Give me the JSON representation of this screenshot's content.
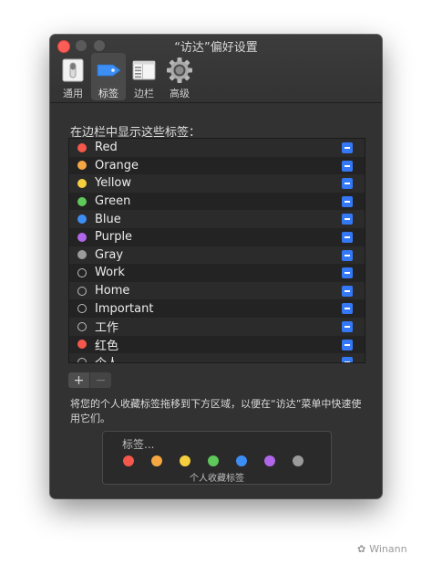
{
  "window": {
    "title": "“访达”偏好设置"
  },
  "toolbar": {
    "items": [
      {
        "label": "通用",
        "icon": "general-switch-icon"
      },
      {
        "label": "标签",
        "icon": "tag-icon",
        "selected": true
      },
      {
        "label": "边栏",
        "icon": "sidebar-icon"
      },
      {
        "label": "高级",
        "icon": "gear-icon"
      }
    ]
  },
  "tags_section": {
    "heading": "在边栏中显示这些标签：",
    "tags": [
      {
        "label": "Red",
        "color": "#f4574b"
      },
      {
        "label": "Orange",
        "color": "#f5a742"
      },
      {
        "label": "Yellow",
        "color": "#f6cf3f"
      },
      {
        "label": "Green",
        "color": "#5ec85a"
      },
      {
        "label": "Blue",
        "color": "#3d8ef4"
      },
      {
        "label": "Purple",
        "color": "#b066e8"
      },
      {
        "label": "Gray",
        "color": "#9b9b9b"
      },
      {
        "label": "Work",
        "color": ""
      },
      {
        "label": "Home",
        "color": ""
      },
      {
        "label": "Important",
        "color": ""
      },
      {
        "label": "工作",
        "color": ""
      },
      {
        "label": "红色",
        "color": "#f4574b"
      },
      {
        "label": "个人",
        "color": ""
      }
    ]
  },
  "buttons": {
    "add": "+",
    "remove": "−"
  },
  "description": "将您的个人收藏标签拖移到下方区域，以便在“访达”菜单中快速使用它们。",
  "favorites": {
    "placeholder": "标签...",
    "caption": "个人收藏标签",
    "colors": [
      "#f4574b",
      "#f5a742",
      "#f6cf3f",
      "#5ec85a",
      "#3d8ef4",
      "#b066e8",
      "#9b9b9b"
    ]
  },
  "watermark": {
    "text": "Winann",
    "icon": "wechat-icon"
  },
  "colors": {
    "accent": "#3478f6"
  }
}
